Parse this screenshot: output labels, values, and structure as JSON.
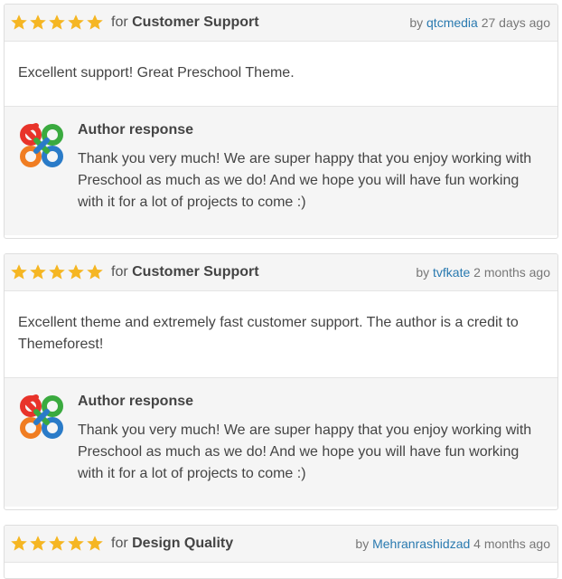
{
  "reviews": [
    {
      "rating": 5,
      "for_prefix": "for ",
      "category": "Customer Support",
      "by_prefix": "by ",
      "author": "qtcmedia",
      "time": " 27 days ago",
      "body": "Excellent support! Great Preschool Theme.",
      "response_title": "Author response",
      "response_text": "Thank you very much! We are super happy that you enjoy working with Preschool as much as we do! And we hope you will have fun working with it for a lot of projects to come :)"
    },
    {
      "rating": 5,
      "for_prefix": "for ",
      "category": "Customer Support",
      "by_prefix": "by ",
      "author": "tvfkate",
      "time": " 2 months ago",
      "body": "Excellent theme and extremely fast customer support. The author is a credit to Themeforest!",
      "response_title": "Author response",
      "response_text": "Thank you very much! We are super happy that you enjoy working with Preschool as much as we do! And we hope you will have fun working with it for a lot of projects to come :)"
    },
    {
      "rating": 5,
      "for_prefix": "for ",
      "category": "Design Quality",
      "by_prefix": "by ",
      "author": "Mehranrashidzad",
      "time": " 4 months ago"
    }
  ],
  "icons": {
    "star": "star-icon",
    "author_logo": "author-logo-icon"
  },
  "colors": {
    "star": "#f5b623",
    "link": "#2a7ab0",
    "logo_red": "#e8332a",
    "logo_green": "#3aaa3f",
    "logo_blue": "#2a7bc8",
    "logo_orange": "#f07d22"
  }
}
